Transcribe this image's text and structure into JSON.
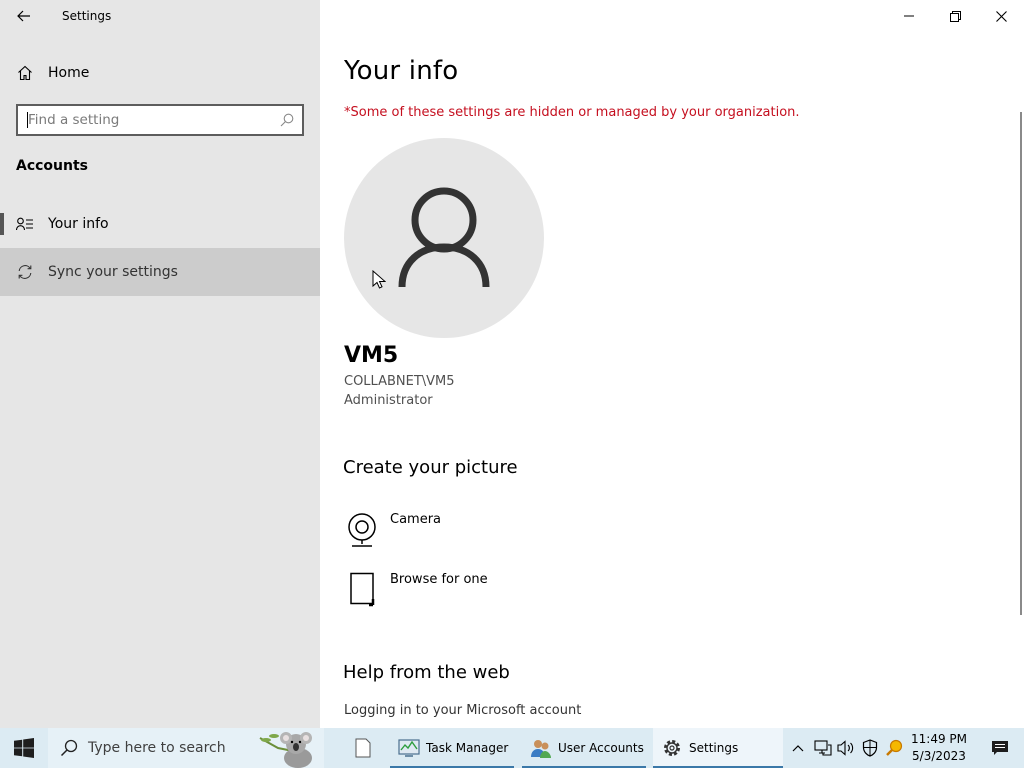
{
  "window": {
    "title": "Settings"
  },
  "sidebar": {
    "home_label": "Home",
    "search": {
      "placeholder": "Find a setting",
      "value": ""
    },
    "section_title": "Accounts",
    "items": [
      {
        "label": "Your info",
        "icon": "person-list-icon",
        "selected": true
      },
      {
        "label": "Sync your settings",
        "icon": "sync-icon",
        "selected": false
      }
    ]
  },
  "main": {
    "title": "Your info",
    "org_warning": "*Some of these settings are hidden or managed by your organization.",
    "user": {
      "name": "VM5",
      "domain": "COLLABNET\\VM5",
      "role": "Administrator"
    },
    "create_picture": {
      "heading": "Create your picture",
      "options": [
        {
          "label": "Camera",
          "icon": "camera-icon"
        },
        {
          "label": "Browse for one",
          "icon": "document-icon"
        }
      ]
    },
    "help": {
      "heading": "Help from the web",
      "link": "Logging in to your Microsoft account"
    }
  },
  "taskbar": {
    "search_placeholder": "Type here to search",
    "apps": [
      {
        "label": "",
        "icon": "blank-document-icon"
      },
      {
        "label": "Task Manager",
        "icon": "task-manager-icon"
      },
      {
        "label": "User Accounts",
        "icon": "user-accounts-icon"
      },
      {
        "label": "Settings",
        "icon": "gear-icon",
        "active": true
      }
    ],
    "clock": {
      "time": "11:49 PM",
      "date": "5/3/2023"
    }
  },
  "colors": {
    "sidebar_bg": "#e6e6e6",
    "warning": "#c50f1f",
    "taskbar_bg": "#dcebf3",
    "selection_bar": "#555555"
  }
}
